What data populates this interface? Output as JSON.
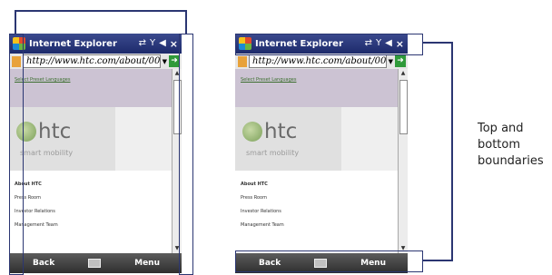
{
  "browser": {
    "title": "Internet Explorer",
    "url": "http://www.htc.com/about/00-",
    "page_link": "Select Preset Languages",
    "logo_text": "htc",
    "tagline": "smart mobility",
    "menu_items": [
      "About HTC",
      "Press Room",
      "Investor Relations",
      "Management Team"
    ],
    "softkey_left": "Back",
    "softkey_right": "Menu"
  },
  "annotation": {
    "label": "Top and bottom boundaries",
    "color": "#2b3672"
  }
}
